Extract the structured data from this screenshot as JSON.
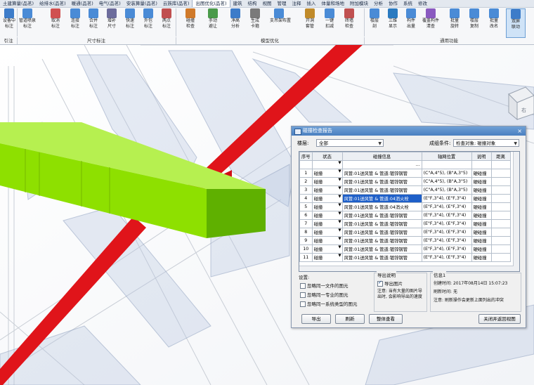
{
  "ribbon": {
    "tabs": [
      "土建算量(品茗)",
      "给排水(品茗)",
      "暖通(品茗)",
      "电气(品茗)",
      "安装算量(品茗)",
      "云族库(品茗)",
      "出图优化(品茗)",
      "建筑",
      "结构",
      "视图",
      "管理",
      "注释",
      "插入",
      "体量和场地",
      "附加模块",
      "分析",
      "协作",
      "系统",
      "修改"
    ],
    "active_tab_index": 6,
    "tools": [
      {
        "label": "设备中\n标注"
      },
      {
        "label": "管道喷泉\n标注"
      },
      {
        "label": "取消\n标注"
      },
      {
        "label": "连接\n标注"
      },
      {
        "label": "合并\n标注"
      },
      {
        "label": "增补\n尺寸"
      },
      {
        "label": "快速\n标注"
      },
      {
        "label": "外包\n标注"
      },
      {
        "label": "两点\n标注"
      },
      {
        "label": "碰撞\n检查"
      },
      {
        "label": "手动\n避让"
      },
      {
        "label": "净高\n分析"
      },
      {
        "label": "生成\n卡箍"
      },
      {
        "label": "支吊架布置"
      },
      {
        "label": "开洞\n套管"
      },
      {
        "label": "一键\n扣减"
      },
      {
        "label": "砖墙\n检查"
      },
      {
        "label": "楼层\n剖"
      },
      {
        "label": "三维\n显示"
      },
      {
        "label": "构件\n出量"
      },
      {
        "label": "覆盖构件\n清查"
      },
      {
        "label": "批量\n旋转"
      },
      {
        "label": "楼层\n复制"
      },
      {
        "label": "批量\n改名"
      },
      {
        "label": "双屏\n联动"
      }
    ],
    "groups": {
      "g1": "引注",
      "g2": "尺寸标注",
      "g3": "模型优化",
      "g4": "通用功能"
    }
  },
  "dialog": {
    "title": "碰撞检查报告",
    "close": "×",
    "floor_label": "楼层:",
    "floor_value": "全部",
    "cond_label": "成组条件:",
    "cond_value": "检查对象: 碰撞对象",
    "columns": [
      "序号",
      "状态",
      "碰撞信息",
      "轴网位置",
      "说明",
      "距离"
    ],
    "filter_dots": "...",
    "rows": [
      {
        "no": "1",
        "status": "碰撞",
        "info": "风管:01送风管 & 管道:镀锌钢管",
        "axis": "(C\"A,4\"5), (B\"A,3\"5)",
        "note": "硬碰撞",
        "hl": false
      },
      {
        "no": "2",
        "status": "碰撞",
        "info": "风管:01送风管 & 管道:镀锌钢管",
        "axis": "(C\"A,4\"5), (B\"A,3\"5)",
        "note": "硬碰撞",
        "hl": false
      },
      {
        "no": "3",
        "status": "碰撞",
        "info": "风管:01送风管 & 管道:镀锌钢管",
        "axis": "(C\"A,4\"5), (B\"A,3\"5)",
        "note": "硬碰撞",
        "hl": false
      },
      {
        "no": "4",
        "status": "碰撞",
        "info": "风管:01送风管 & 管道:04消火栓",
        "axis": "(E\"F,3\"4), (E\"F,3\"4)",
        "note": "硬碰撞",
        "hl": true
      },
      {
        "no": "5",
        "status": "碰撞",
        "info": "风管:01送风管 & 管道:04消火栓",
        "axis": "(E\"F,3\"4), (E\"F,3\"4)",
        "note": "硬碰撞",
        "hl": false
      },
      {
        "no": "6",
        "status": "碰撞",
        "info": "风管:01送风管 & 管道:镀锌钢管",
        "axis": "(E\"F,3\"4), (E\"F,3\"4)",
        "note": "硬碰撞",
        "hl": false
      },
      {
        "no": "7",
        "status": "碰撞",
        "info": "风管:01送风管 & 管道:镀锌钢管",
        "axis": "(E\"F,3\"4), (E\"F,3\"4)",
        "note": "硬碰撞",
        "hl": false
      },
      {
        "no": "8",
        "status": "碰撞",
        "info": "风管:01送风管 & 管道:镀锌钢管",
        "axis": "(E\"F,3\"4), (E\"F,3\"4)",
        "note": "硬碰撞",
        "hl": false
      },
      {
        "no": "9",
        "status": "碰撞",
        "info": "风管:01送风管 & 管道:镀锌钢管",
        "axis": "(E\"F,3\"4), (E\"F,3\"4)",
        "note": "硬碰撞",
        "hl": false
      },
      {
        "no": "10",
        "status": "碰撞",
        "info": "风管:01送风管 & 管道:镀锌钢管",
        "axis": "(E\"F,3\"4), (E\"F,3\"4)",
        "note": "硬碰撞",
        "hl": false
      },
      {
        "no": "11",
        "status": "碰撞",
        "info": "风管:01送风管 & 管道:镀锌钢管",
        "axis": "(E\"F,3\"4), (E\"F,3\"4)",
        "note": "硬碰撞",
        "hl": false
      }
    ],
    "settings_title": "设置:",
    "settings": [
      "忽略同一文件的图元",
      "忽略同一专业的图元",
      "忽略同一系统类型的图元"
    ],
    "export_title": "导出说明",
    "export_checkbox": "导出图片",
    "export_note": "注意: 当有大量的图片导出时, 会影响导出的速度",
    "info_title": "信息1",
    "created_label": "创建时间:",
    "created_value": "2017年08月14日 15:07:23",
    "refresh_label": "刷新时间:",
    "refresh_value": "无",
    "info_note": "注意: 刷新操作会更新上面列出的冲突",
    "buttons": {
      "export": "导出",
      "refresh": "刷新",
      "overall": "整体查看",
      "close": "关闭并返回视图"
    }
  },
  "colors": {
    "green_duct": "#8ee000",
    "red_pipe": "#e0141a",
    "highlight": "#1e5fc8",
    "title_bar": "#5b8fcd"
  }
}
